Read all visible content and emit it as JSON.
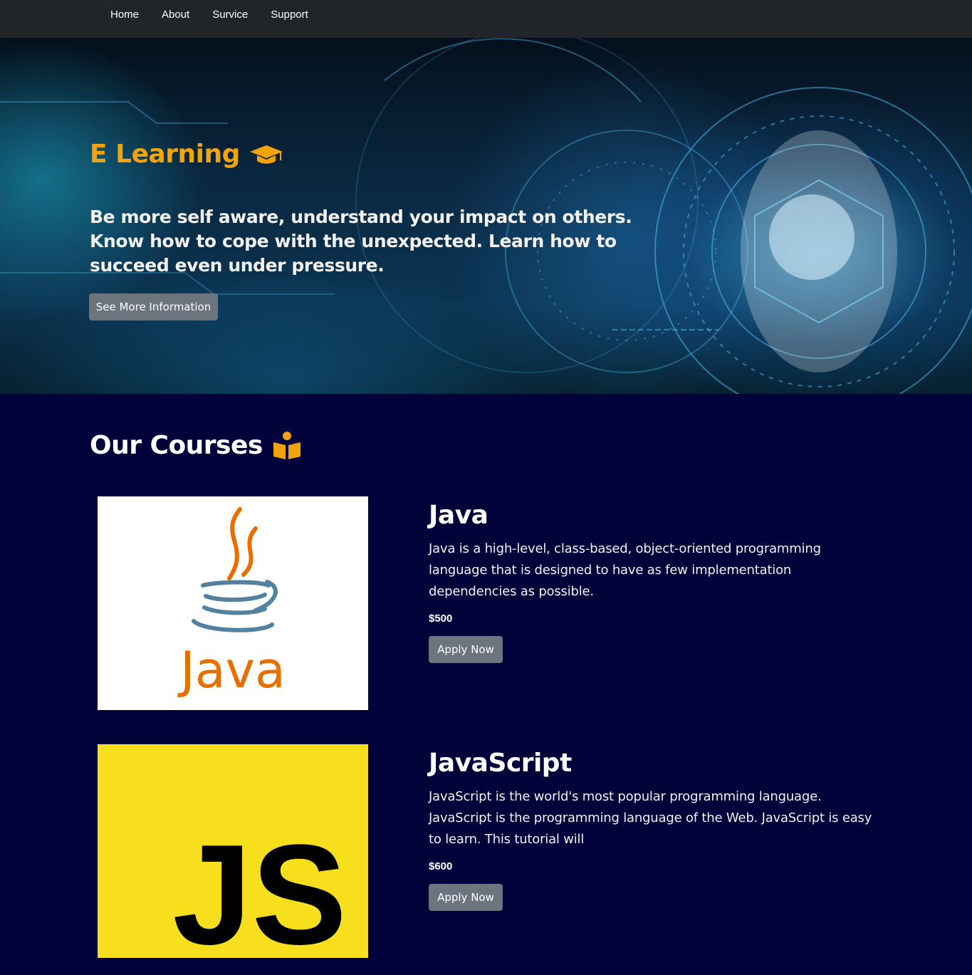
{
  "nav": {
    "items": [
      {
        "label": "Home"
      },
      {
        "label": "About"
      },
      {
        "label": "Survice"
      },
      {
        "label": "Support"
      }
    ]
  },
  "hero": {
    "title": "E Learning",
    "title_icon": "graduation-cap-icon",
    "text": "Be more self aware, understand your impact on others. Know how to cope with the unexpected. Learn how to succeed even under pressure.",
    "button_label": "See More Information"
  },
  "courses_section": {
    "title": "Our Courses",
    "title_icon": "book-reader-icon"
  },
  "courses": [
    {
      "title": "Java",
      "logo": "java-logo",
      "logo_text": "Java",
      "description": "Java is a high-level, class-based, object-oriented programming language that is designed to have as few implementation dependencies as possible.",
      "price": "$500",
      "button_label": "Apply Now"
    },
    {
      "title": "JavaScript",
      "logo": "javascript-logo",
      "logo_text": "JS",
      "description": "JavaScript is the world's most popular programming language. JavaScript is the programming language of the Web. JavaScript is easy to learn. This tutorial will",
      "price": "$600",
      "button_label": "Apply Now"
    }
  ],
  "colors": {
    "navbar": "#212529",
    "page_background": "#02023a",
    "accent": "#f2a40c",
    "button": "#6c757d",
    "js_yellow": "#f7df1e",
    "java_orange": "#e76f00",
    "java_blue": "#5382a1"
  }
}
